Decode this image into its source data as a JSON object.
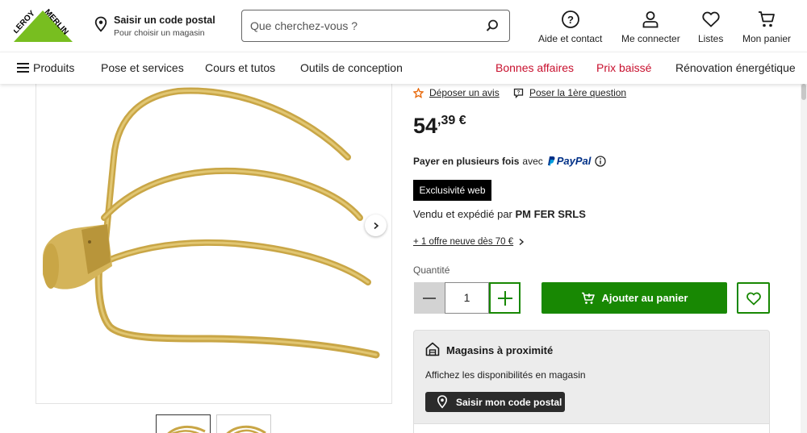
{
  "header": {
    "logo_text": "LEROY MERLIN",
    "postal": {
      "title": "Saisir un code postal",
      "subtitle": "Pour choisir un magasin"
    },
    "search": {
      "placeholder": "Que cherchez-vous ?"
    },
    "icons": [
      {
        "label": "Aide et contact",
        "icon": "help-circle-icon"
      },
      {
        "label": "Me connecter",
        "icon": "user-icon"
      },
      {
        "label": "Listes",
        "icon": "heart-icon"
      },
      {
        "label": "Mon panier",
        "icon": "cart-icon"
      }
    ]
  },
  "nav": {
    "products": "Produits",
    "pose": "Pose et services",
    "cours": "Cours et tutos",
    "outils": "Outils de conception",
    "bonnes": "Bonnes affaires",
    "prix": "Prix baissé",
    "renov": "Rénovation énergétique"
  },
  "product": {
    "review_link": "Déposer un avis",
    "question_link": "Poser la 1ère question",
    "price_int": "54",
    "price_dec": ",39 €",
    "paypal_prefix": "Payer en plusieurs fois",
    "paypal_avec": "avec",
    "paypal_brand": "PayPal",
    "badge": "Exclusivité web",
    "seller_prefix": "Vendu et expédié par",
    "seller_name": "PM FER SRLS",
    "offer_link": "+ 1 offre neuve dès 70 €",
    "qty_label": "Quantité",
    "qty_value": "1",
    "add_to_cart": "Ajouter au panier"
  },
  "stores": {
    "title": "Magasins à proximité",
    "desc": "Affichez les disponibilités en magasin",
    "button": "Saisir mon code postal"
  },
  "colors": {
    "brand_green": "#188803",
    "logo_green": "#78be20",
    "promo_red": "#c8102e",
    "paypal_dark": "#003087",
    "paypal_light": "#009cde"
  }
}
